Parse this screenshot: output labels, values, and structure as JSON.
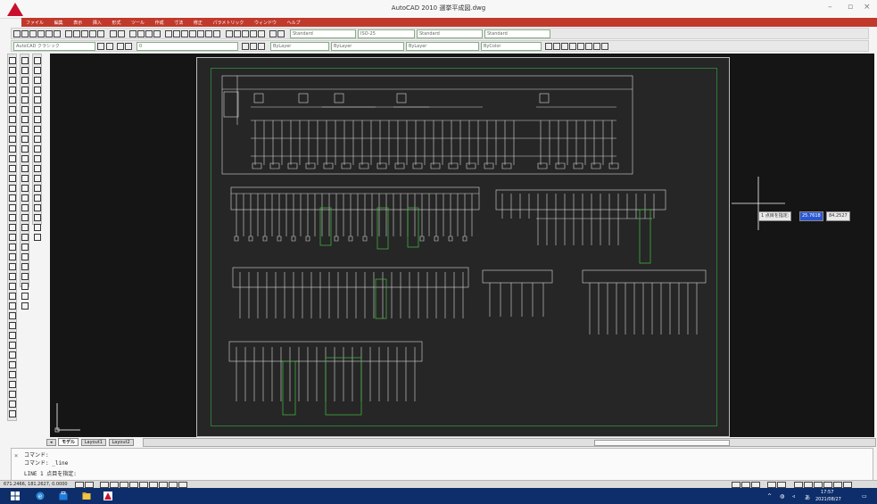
{
  "window": {
    "title": "AutoCAD 2010  選挙平成図.dwg",
    "minimize": "–",
    "maximize": "▫",
    "close": "×"
  },
  "menu": [
    "ファイル",
    "編集",
    "表示",
    "挿入",
    "形式",
    "ツール",
    "作成",
    "寸法",
    "修正",
    "パラメトリック",
    "ウィンドウ",
    "ヘルプ"
  ],
  "toolbar": {
    "workspace": "AutoCAD クラシック",
    "layer": "0",
    "linetype1": "ByLayer",
    "linetype2": "ByLayer",
    "lineweight": "ByLayer",
    "plotstyle": "ByColor",
    "textstyle": "Standard",
    "dimstyle": "ISO-25",
    "tablestyle": "Standard",
    "mleaderstyle": "Standard",
    "color": "ByLayer"
  },
  "tabs": [
    "モデル",
    "Layout1",
    "Layout2"
  ],
  "dynamic_input": {
    "prompt": "1 点目を指定:",
    "x": "25.7618",
    "y": "84.2527"
  },
  "command": {
    "line1": "コマンド:",
    "line2": "コマンド: _line",
    "line3": "LINE 1 点目を指定:"
  },
  "status": {
    "coords": "671.2466, 181.2627, 0.0000"
  },
  "tray": {
    "ime": "あ",
    "time": "17:57",
    "date": "2021/08/27"
  },
  "colors": {
    "app_red": "#c8102e",
    "canvas": "#151515",
    "taskbar": "#0d2e6b",
    "schematic_green": "#3fae3f",
    "crosshair": "#ffffff"
  }
}
